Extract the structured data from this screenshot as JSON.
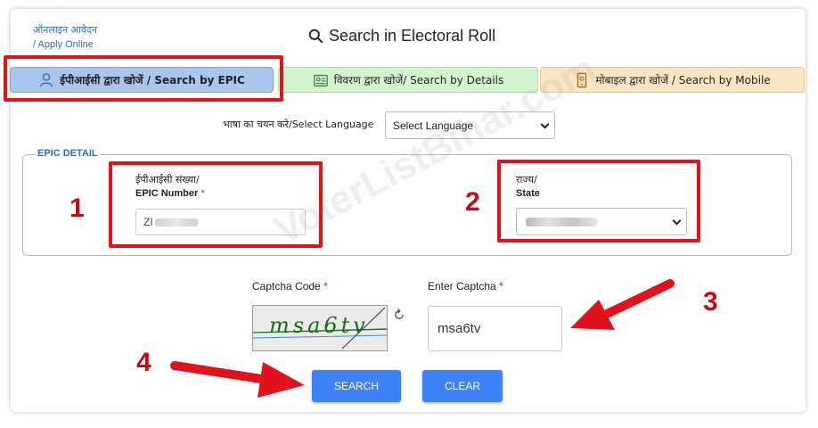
{
  "header": {
    "apply_hindi": "ऑनलाइन आवेदन",
    "apply_english": "/ Apply Online",
    "title": "Search in Electoral Roll"
  },
  "tabs": [
    {
      "label": "ईपीआईसी द्वारा खोजें / Search by EPIC",
      "icon": "person-icon",
      "color": "#a9c7ee",
      "active": true
    },
    {
      "label": "विवरण द्वारा खोजें/ Search by Details",
      "icon": "id-card-icon",
      "color": "#d4f4cf",
      "active": false
    },
    {
      "label": "मोबाइल द्वारा खोजें / Search by Mobile",
      "icon": "mobile-icon",
      "color": "#fbe6c4",
      "active": false
    }
  ],
  "language": {
    "label": "भाषा का चयन करे/Select Language",
    "selected": "Select Language"
  },
  "epic_detail": {
    "legend": "EPIC DETAIL",
    "epic_label_hi": "ईपीआईसी संख्या/",
    "epic_label_en": "EPIC Number",
    "epic_value_prefix": "ZI",
    "state_label_hi": "राज्य/",
    "state_label_en": "State",
    "required_mark": "*"
  },
  "captcha": {
    "label": "Captcha Code",
    "image_text": "msa6tv",
    "enter_label": "Enter Captcha",
    "enter_value": "msa6tv"
  },
  "buttons": {
    "search": "SEARCH",
    "clear": "CLEAR"
  },
  "annotations": {
    "step1": "1",
    "step2": "2",
    "step3": "3",
    "step4": "4",
    "highlight_color": "#e0121b",
    "watermark": "VoterListBihar.com"
  },
  "colors": {
    "primary_button": "#3e82f7",
    "link": "#2f6fb6"
  }
}
